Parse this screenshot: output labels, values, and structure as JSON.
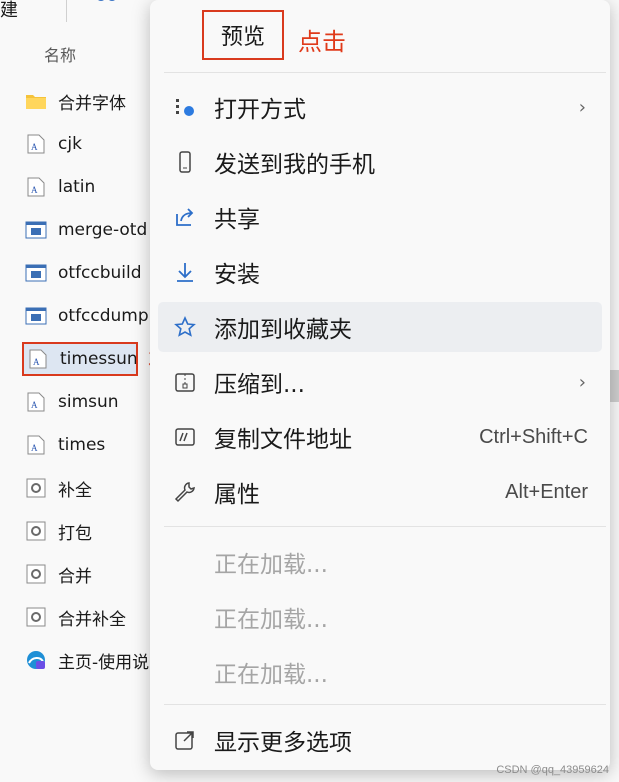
{
  "topbar": {
    "partial_text": "建"
  },
  "explorer": {
    "column_header": "名称",
    "files": [
      {
        "name": "合并字体",
        "icon": "folder-icon"
      },
      {
        "name": "cjk",
        "icon": "font-file-icon"
      },
      {
        "name": "latin",
        "icon": "font-file-icon"
      },
      {
        "name": "merge-otd",
        "icon": "app-window-icon"
      },
      {
        "name": "otfccbuild",
        "icon": "app-window-icon"
      },
      {
        "name": "otfccdump",
        "icon": "app-window-icon"
      },
      {
        "name": "timessun",
        "icon": "font-file-icon"
      },
      {
        "name": "simsun",
        "icon": "font-file-icon"
      },
      {
        "name": "times",
        "icon": "font-file-icon"
      },
      {
        "name": "补全",
        "icon": "script-gear-icon"
      },
      {
        "name": "打包",
        "icon": "script-gear-icon"
      },
      {
        "name": "合并",
        "icon": "script-gear-icon"
      },
      {
        "name": "合并补全",
        "icon": "script-gear-icon"
      },
      {
        "name": "主页-使用说",
        "icon": "edge-browser-icon"
      }
    ],
    "selected_file": "timessun"
  },
  "annotations": {
    "right_click": "右键",
    "click": "点击"
  },
  "menu": {
    "preview": "预览",
    "items": [
      {
        "label": "打开方式",
        "icon": "open-with-icon",
        "shortcut": "",
        "has_submenu": true
      },
      {
        "label": "发送到我的手机",
        "icon": "phone-icon",
        "shortcut": "",
        "has_submenu": false
      },
      {
        "label": "共享",
        "icon": "share-icon",
        "shortcut": "",
        "has_submenu": false
      },
      {
        "label": "安装",
        "icon": "download-icon",
        "shortcut": "",
        "has_submenu": false
      },
      {
        "label": "添加到收藏夹",
        "icon": "star-icon",
        "shortcut": "",
        "has_submenu": false
      },
      {
        "label": "压缩到...",
        "icon": "zip-icon",
        "shortcut": "",
        "has_submenu": true
      },
      {
        "label": "复制文件地址",
        "icon": "copy-path-icon",
        "shortcut": "Ctrl+Shift+C",
        "has_submenu": false
      },
      {
        "label": "属性",
        "icon": "wrench-icon",
        "shortcut": "Alt+Enter",
        "has_submenu": false
      }
    ],
    "loading": [
      "正在加载...",
      "正在加载...",
      "正在加载..."
    ],
    "more_options": "显示更多选项"
  },
  "watermark": "CSDN @qq_43959624"
}
